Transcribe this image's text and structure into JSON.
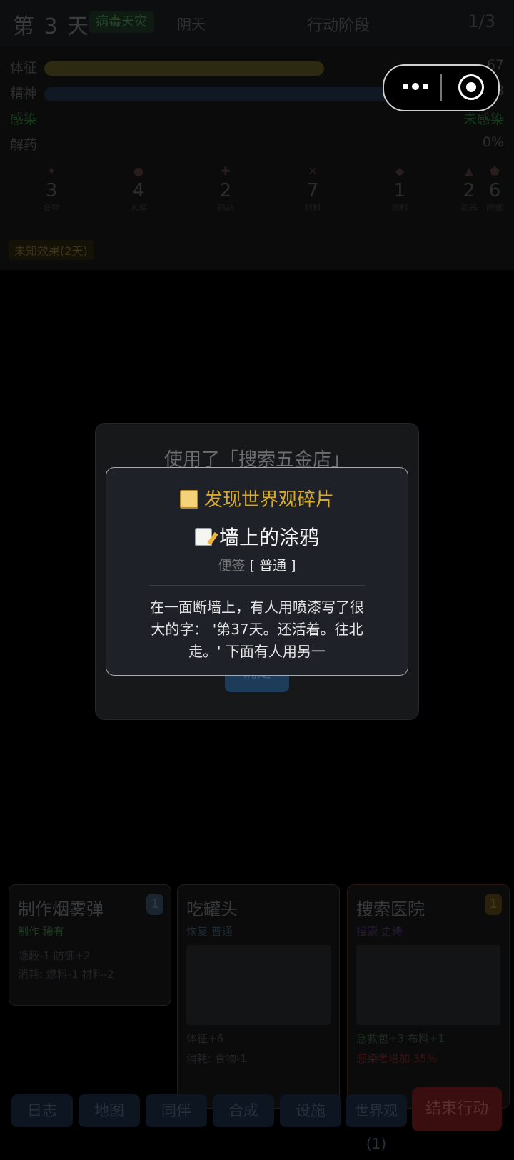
{
  "topbar": {
    "day": "第 3 天",
    "badge": "病毒天灾",
    "weather": "阴天",
    "phase": "行动阶段",
    "counter": "1/3"
  },
  "stats": {
    "health": {
      "label": "体征",
      "value": "67",
      "fill": 0.67,
      "color": "#2e2a12"
    },
    "spirit": {
      "label": "精神",
      "value": "8",
      "fill": 0.8,
      "color": "#101824"
    },
    "infection": {
      "label": "感染",
      "value": "未感染"
    },
    "antidote": {
      "label": "解药",
      "value": "0%"
    }
  },
  "resources": [
    {
      "icon": "food-icon",
      "value": "3",
      "name": "食物"
    },
    {
      "icon": "water-icon",
      "value": "4",
      "name": "水源"
    },
    {
      "icon": "medicine-icon",
      "value": "2",
      "name": "药品"
    },
    {
      "icon": "material-icon",
      "value": "7",
      "name": "材料"
    },
    {
      "icon": "fuel-icon",
      "value": "1",
      "name": "燃料"
    },
    {
      "icon": "weapon-icon",
      "value": "2",
      "name": "武器"
    },
    {
      "icon": "defense-icon",
      "value": "6",
      "name": "防御"
    }
  ],
  "effect": "未知效果(2天)",
  "background_dialog": {
    "title": "使用了「搜索五金店」",
    "confirm": "确定"
  },
  "popup": {
    "title": "发现世界观碎片",
    "item_name": "墙上的涂鸦",
    "type": "便签",
    "rarity": "普通",
    "text_line1": "在一面断墙上，有人用喷漆写了很",
    "text_line2": "大的字：  '第37天。还活着。往北",
    "text_line3": "走。'  下面有人用另一"
  },
  "cards": [
    {
      "title": "制作烟雾弹",
      "cost": "1",
      "tag": "制作 稀有",
      "line1": "隐蔽-1 防御+2",
      "line2": "消耗: 燃料-1 材料-2"
    },
    {
      "title": "吃罐头",
      "cost": "",
      "tag": "恢复 普通",
      "line1": "体征+6",
      "line2": "消耗: 食物-1"
    },
    {
      "title": "搜索医院",
      "cost": "1",
      "tag": "搜索 史诗",
      "line1": "急救包+3 布料+1",
      "line2": "感染者增加 35%"
    }
  ],
  "nav": {
    "log": "日志",
    "map": "地图",
    "companion": "同伴",
    "craft": "合成",
    "facility": "设施",
    "worldview": "世界观(1)",
    "end_turn": "结束行动"
  }
}
